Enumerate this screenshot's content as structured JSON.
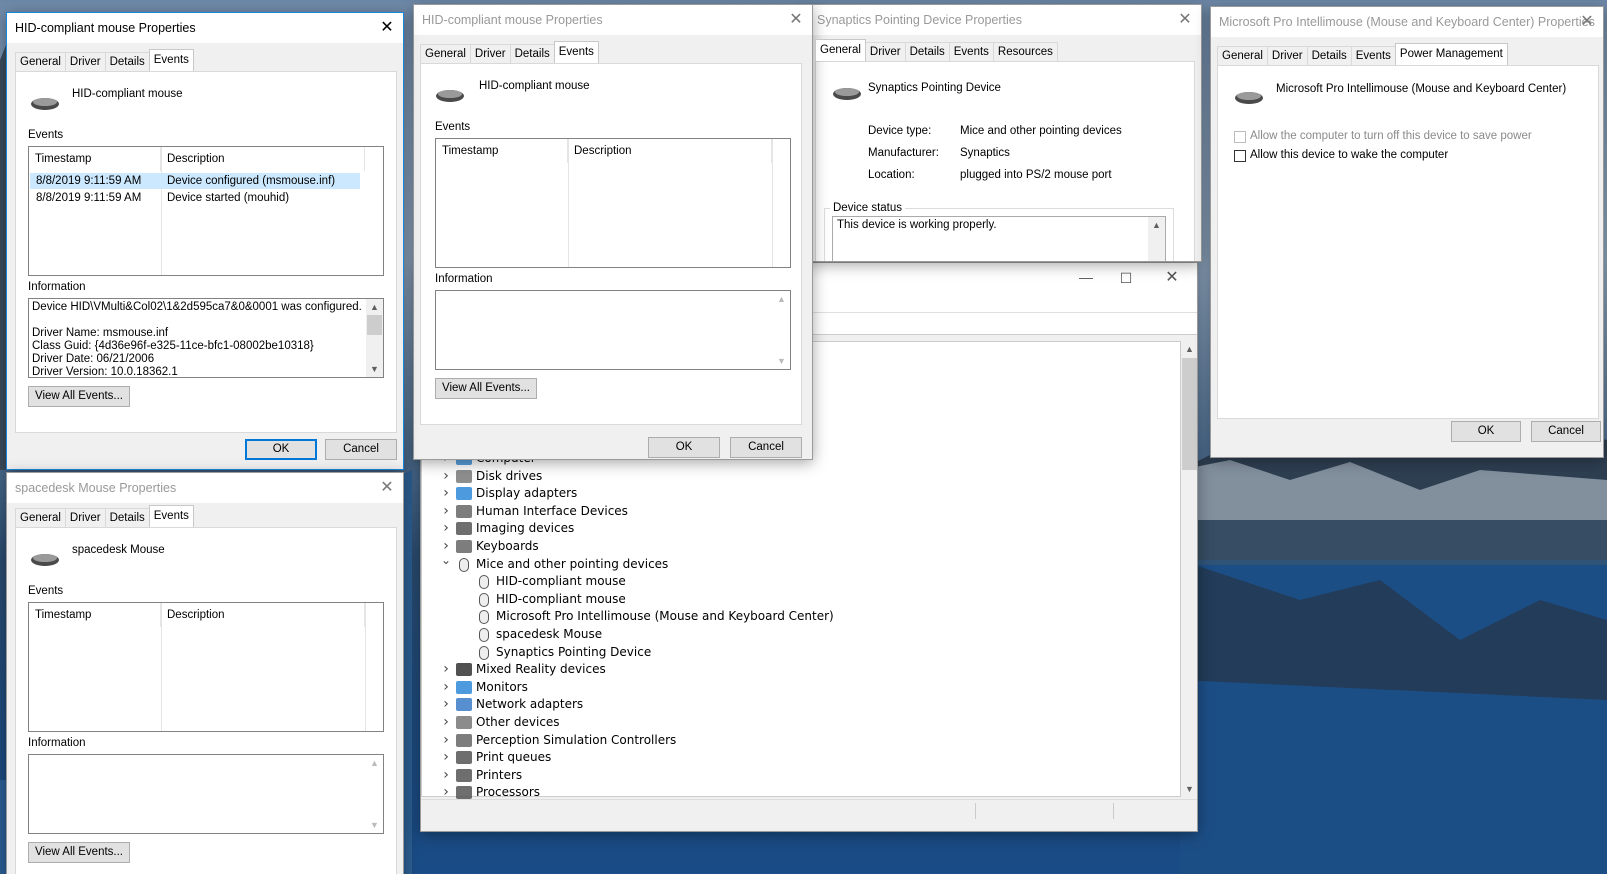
{
  "win1": {
    "title": "HID-compliant mouse Properties",
    "tabs": [
      "General",
      "Driver",
      "Details",
      "Events"
    ],
    "device_name": "HID-compliant mouse",
    "events_label": "Events",
    "col_timestamp": "Timestamp",
    "col_description": "Description",
    "events": [
      {
        "timestamp": "8/8/2019 9:11:59 AM",
        "description": "Device configured (msmouse.inf)"
      },
      {
        "timestamp": "8/8/2019 9:11:59 AM",
        "description": "Device started (mouhid)"
      }
    ],
    "info_label": "Information",
    "info_lines": [
      "Device HID\\VMulti&Col02\\1&2d595ca7&0&0001 was configured.",
      "",
      "Driver Name: msmouse.inf",
      "Class Guid: {4d36e96f-e325-11ce-bfc1-08002be10318}",
      "Driver Date: 06/21/2006",
      "Driver Version: 10.0.18362.1"
    ],
    "view_all": "View All Events...",
    "ok": "OK",
    "cancel": "Cancel"
  },
  "win2": {
    "title": "HID-compliant mouse Properties",
    "tabs": [
      "General",
      "Driver",
      "Details",
      "Events"
    ],
    "device_name": "HID-compliant mouse",
    "events_label": "Events",
    "col_timestamp": "Timestamp",
    "col_description": "Description",
    "info_label": "Information",
    "view_all": "View All Events...",
    "ok": "OK",
    "cancel": "Cancel"
  },
  "win3": {
    "title": "Synaptics Pointing Device Properties",
    "tabs": [
      "General",
      "Driver",
      "Details",
      "Events",
      "Resources"
    ],
    "device_name": "Synaptics Pointing Device",
    "device_type_label": "Device type:",
    "device_type": "Mice and other pointing devices",
    "manufacturer_label": "Manufacturer:",
    "manufacturer": "Synaptics",
    "location_label": "Location:",
    "location": "plugged into PS/2 mouse port",
    "status_label": "Device status",
    "status": "This device is working properly."
  },
  "win4": {
    "title": "Microsoft Pro Intellimouse (Mouse and Keyboard Center) Properties",
    "tabs": [
      "General",
      "Driver",
      "Details",
      "Events",
      "Power Management"
    ],
    "device_name": "Microsoft Pro Intellimouse (Mouse and Keyboard Center)",
    "opt_turn_off": "Allow the computer to turn off this device to save power",
    "opt_wake": "Allow this device to wake the computer",
    "ok": "OK",
    "cancel": "Cancel"
  },
  "win5": {
    "title": "spacedesk Mouse Properties",
    "tabs": [
      "General",
      "Driver",
      "Details",
      "Events"
    ],
    "device_name": "spacedesk Mouse",
    "events_label": "Events",
    "col_timestamp": "Timestamp",
    "col_description": "Description",
    "info_label": "Information",
    "view_all": "View All Events..."
  },
  "devmgr": {
    "tree": [
      {
        "label": "Computer",
        "icon": "computer-icon",
        "expanded": false
      },
      {
        "label": "Disk drives",
        "icon": "disk-icon",
        "expanded": false
      },
      {
        "label": "Display adapters",
        "icon": "monitor-icon",
        "expanded": false
      },
      {
        "label": "Human Interface Devices",
        "icon": "hid-icon",
        "expanded": false
      },
      {
        "label": "Imaging devices",
        "icon": "camera-icon",
        "expanded": false
      },
      {
        "label": "Keyboards",
        "icon": "keyboard-icon",
        "expanded": false
      },
      {
        "label": "Mice and other pointing devices",
        "icon": "mouse-icon",
        "expanded": true
      },
      {
        "label": "HID-compliant mouse",
        "icon": "mouse-icon",
        "child": true
      },
      {
        "label": "HID-compliant mouse",
        "icon": "mouse-icon",
        "child": true
      },
      {
        "label": "Microsoft Pro Intellimouse (Mouse and Keyboard Center)",
        "icon": "mouse-icon",
        "child": true
      },
      {
        "label": "spacedesk Mouse",
        "icon": "mouse-icon",
        "child": true
      },
      {
        "label": "Synaptics Pointing Device",
        "icon": "mouse-icon",
        "child": true
      },
      {
        "label": "Mixed Reality devices",
        "icon": "headset-icon",
        "expanded": false
      },
      {
        "label": "Monitors",
        "icon": "monitor-icon",
        "expanded": false
      },
      {
        "label": "Network adapters",
        "icon": "network-icon",
        "expanded": false
      },
      {
        "label": "Other devices",
        "icon": "unknown-device-icon",
        "expanded": false
      },
      {
        "label": "Perception Simulation Controllers",
        "icon": "hid-icon",
        "expanded": false
      },
      {
        "label": "Print queues",
        "icon": "printer-icon",
        "expanded": false
      },
      {
        "label": "Printers",
        "icon": "printer-icon",
        "expanded": false
      },
      {
        "label": "Processors",
        "icon": "chip-icon",
        "expanded": false
      }
    ]
  }
}
